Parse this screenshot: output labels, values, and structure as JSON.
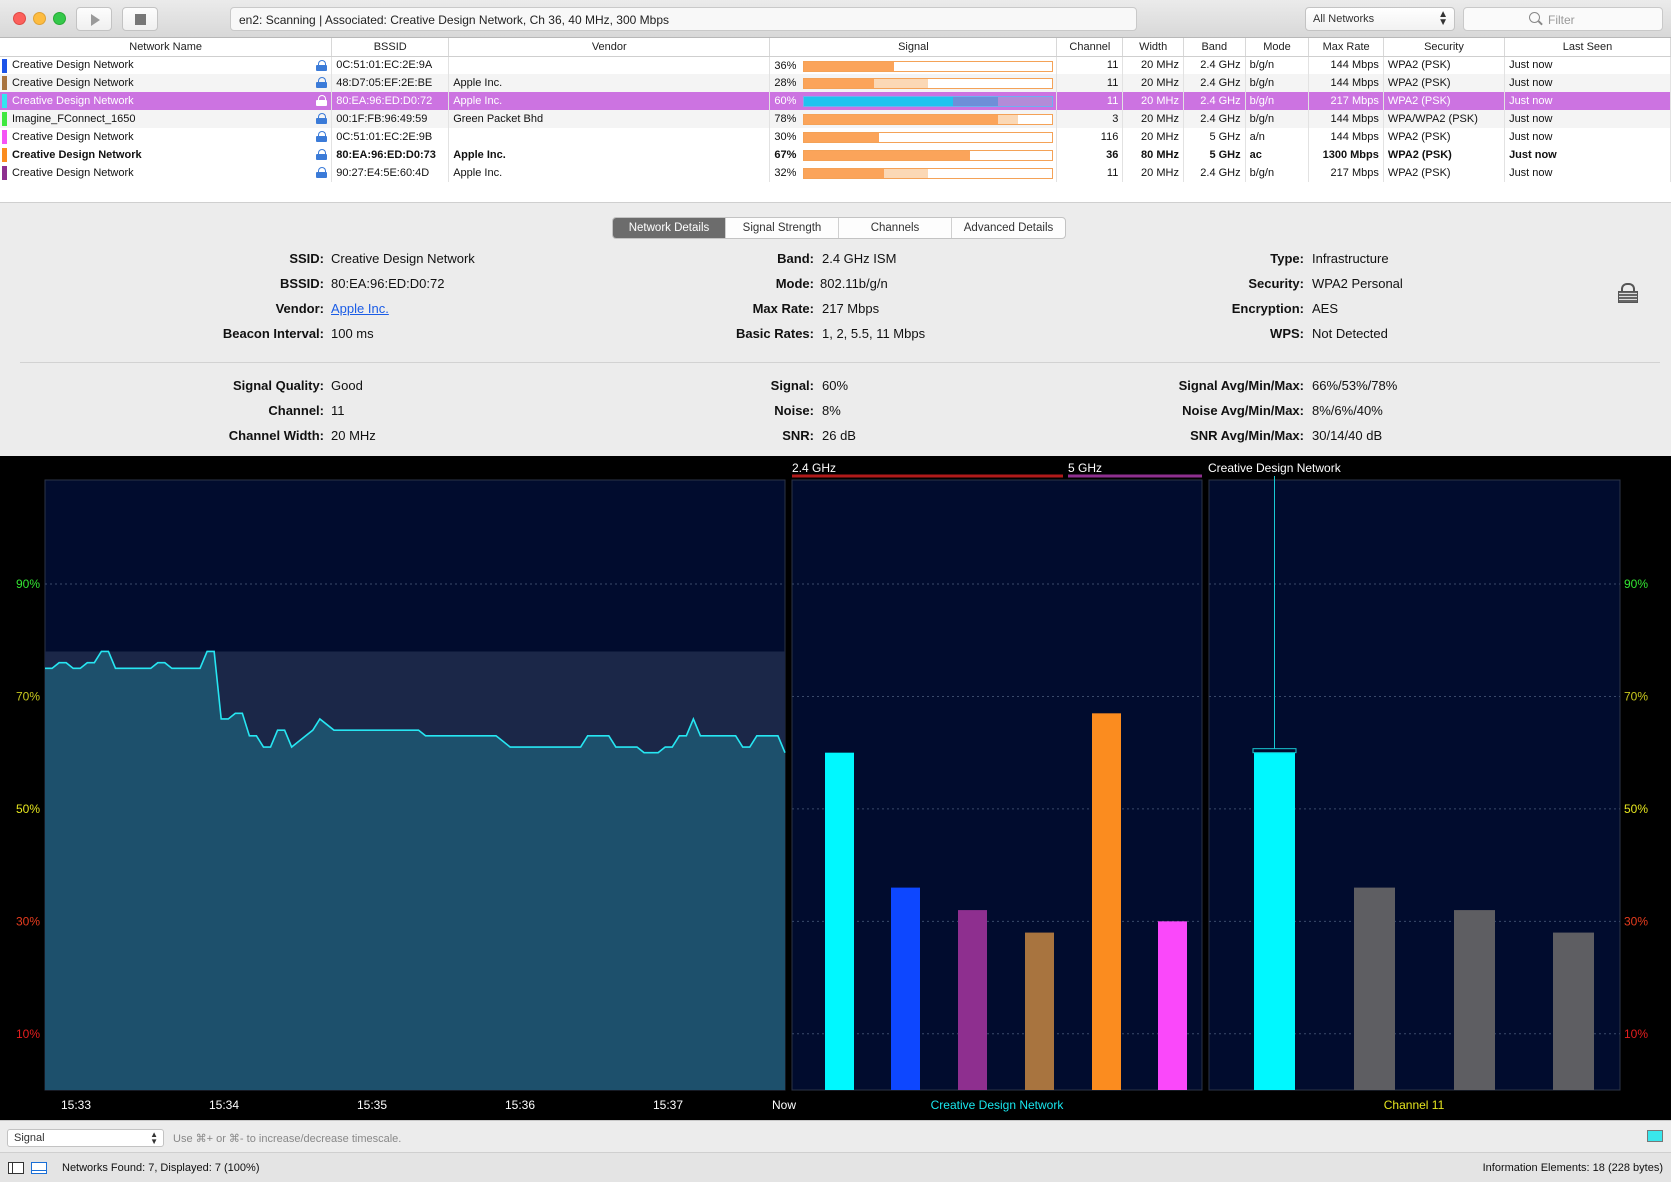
{
  "titlebar": {
    "status": "en2: Scanning  |  Associated: Creative Design Network, Ch 36, 40 MHz, 300 Mbps",
    "network_filter": "All Networks",
    "filter_placeholder": "Filter"
  },
  "table": {
    "columns": [
      "Network Name",
      "BSSID",
      "Vendor",
      "Signal",
      "Channel",
      "Width",
      "Band",
      "Mode",
      "Max Rate",
      "Security",
      "Last Seen"
    ],
    "rows": [
      {
        "color": "#1d54e8",
        "name": "Creative Design Network",
        "bssid": "0C:51:01:EC:2E:9A",
        "vendor": "",
        "signal": "36%",
        "signal_value": 0.36,
        "signal_avg": 0.36,
        "channel": "11",
        "width": "20 MHz",
        "band": "2.4 GHz",
        "mode": "b/g/n",
        "max_rate": "144 Mbps",
        "security": "WPA2 (PSK)",
        "last_seen": "Just now",
        "style": "normal"
      },
      {
        "color": "#a8743f",
        "name": "Creative Design Network",
        "bssid": "48:D7:05:EF:2E:BE",
        "vendor": "Apple Inc.",
        "signal": "28%",
        "signal_value": 0.28,
        "signal_avg": 0.5,
        "channel": "11",
        "width": "20 MHz",
        "band": "2.4 GHz",
        "mode": "b/g/n",
        "max_rate": "144 Mbps",
        "security": "WPA2 (PSK)",
        "last_seen": "Just now",
        "style": "alt"
      },
      {
        "color": "#33e6f0",
        "name": "Creative Design Network",
        "bssid": "80:EA:96:ED:D0:72",
        "vendor": "Apple Inc.",
        "signal": "60%",
        "signal_value": 0.6,
        "signal_avg": 0.78,
        "channel": "11",
        "width": "20 MHz",
        "band": "2.4 GHz",
        "mode": "b/g/n",
        "max_rate": "217 Mbps",
        "security": "WPA2 (PSK)",
        "last_seen": "Just now",
        "style": "sel"
      },
      {
        "color": "#3fe83f",
        "name": "Imagine_FConnect_1650",
        "bssid": "00:1F:FB:96:49:59",
        "vendor": "Green Packet Bhd",
        "signal": "78%",
        "signal_value": 0.78,
        "signal_avg": 0.86,
        "channel": "3",
        "width": "20 MHz",
        "band": "2.4 GHz",
        "mode": "b/g/n",
        "max_rate": "144 Mbps",
        "security": "WPA/WPA2 (PSK)",
        "last_seen": "Just now",
        "style": "alt"
      },
      {
        "color": "#f554f5",
        "name": "Creative Design Network",
        "bssid": "0C:51:01:EC:2E:9B",
        "vendor": "",
        "signal": "30%",
        "signal_value": 0.3,
        "signal_avg": 0.3,
        "channel": "116",
        "width": "20 MHz",
        "band": "5 GHz",
        "mode": "a/n",
        "max_rate": "144 Mbps",
        "security": "WPA2 (PSK)",
        "last_seen": "Just now",
        "style": "normal"
      },
      {
        "color": "#fb8c1f",
        "name": "Creative Design Network",
        "bssid": "80:EA:96:ED:D0:73",
        "vendor": "Apple Inc.",
        "signal": "67%",
        "signal_value": 0.67,
        "signal_avg": 0.67,
        "channel": "36",
        "width": "80 MHz",
        "band": "5 GHz",
        "mode": "ac",
        "max_rate": "1300 Mbps",
        "security": "WPA2 (PSK)",
        "last_seen": "Just now",
        "style": "bold"
      },
      {
        "color": "#8e2f8f",
        "name": "Creative Design Network",
        "bssid": "90:27:E4:5E:60:4D",
        "vendor": "Apple Inc.",
        "signal": "32%",
        "signal_value": 0.32,
        "signal_avg": 0.5,
        "channel": "11",
        "width": "20 MHz",
        "band": "2.4 GHz",
        "mode": "b/g/n",
        "max_rate": "217 Mbps",
        "security": "WPA2 (PSK)",
        "last_seen": "Just now",
        "style": "normal"
      }
    ]
  },
  "tabs": [
    "Network Details",
    "Signal Strength",
    "Channels",
    "Advanced Details"
  ],
  "details": {
    "ssid_label": "SSID:",
    "ssid": "Creative Design Network",
    "bssid_label": "BSSID:",
    "bssid": "80:EA:96:ED:D0:72",
    "vendor_label": "Vendor:",
    "vendor": "Apple Inc.",
    "beacon_label": "Beacon Interval:",
    "beacon": "100 ms",
    "band_label": "Band:",
    "band": "2.4 GHz ISM",
    "mode_label": "Mode:",
    "mode": "802.11b/g/n",
    "maxrate_label": "Max Rate:",
    "maxrate": "217 Mbps",
    "basic_label": "Basic Rates:",
    "basic": "1, 2, 5.5, 11 Mbps",
    "type_label": "Type:",
    "type": "Infrastructure",
    "security_label": "Security:",
    "security": "WPA2 Personal",
    "encryption_label": "Encryption:",
    "encryption": "AES",
    "wps_label": "WPS:",
    "wps": "Not Detected",
    "quality_label": "Signal Quality:",
    "quality": "Good",
    "channel_label": "Channel:",
    "channel": "11",
    "cwidth_label": "Channel Width:",
    "cwidth": "20 MHz",
    "signal_label": "Signal:",
    "signal": "60%",
    "noise_label": "Noise:",
    "noise": "8%",
    "snr_label": "SNR:",
    "snr": "26 dB",
    "sigavg_label": "Signal Avg/Min/Max:",
    "sigavg": "66%/53%/78%",
    "noiseavg_label": "Noise Avg/Min/Max:",
    "noiseavg": "8%/6%/40%",
    "snravg_label": "SNR Avg/Min/Max:",
    "snravg": "30/14/40 dB"
  },
  "chart_data": [
    {
      "type": "line",
      "title": "",
      "y_ticks": [
        "90%",
        "70%",
        "50%",
        "30%",
        "10%"
      ],
      "ylim": [
        0,
        100
      ],
      "x_ticks": [
        "15:33",
        "15:34",
        "15:35",
        "15:36",
        "15:37",
        "Now"
      ],
      "max_band": 78,
      "series": [
        {
          "color": "#27e6f2",
          "values": [
            75,
            75,
            76,
            76,
            75,
            75,
            76,
            76,
            78,
            78,
            75,
            75,
            75,
            75,
            75,
            75,
            76,
            76,
            75,
            75,
            75,
            75,
            75,
            78,
            78,
            66,
            66,
            67,
            67,
            63,
            63,
            61,
            61,
            64,
            64,
            61,
            62,
            63,
            64,
            66,
            65,
            64,
            64,
            64,
            64,
            64,
            64,
            64,
            64,
            64,
            64,
            64,
            64,
            64,
            63,
            63,
            63,
            63,
            63,
            63,
            63,
            63,
            63,
            63,
            63,
            62,
            61,
            61,
            61,
            61,
            61,
            61,
            61,
            61,
            61,
            61,
            61,
            63,
            63,
            63,
            63,
            61,
            61,
            61,
            61,
            60,
            60,
            60,
            61,
            61,
            63,
            63,
            66,
            63,
            63,
            63,
            63,
            63,
            63,
            61,
            61,
            63,
            63,
            63,
            63,
            60
          ]
        }
      ]
    },
    {
      "type": "bar",
      "title": "Creative Design Network",
      "band_labels": [
        "2.4 GHz",
        "5 GHz"
      ],
      "ylim": [
        0,
        100
      ],
      "values": [
        60,
        36,
        32,
        28,
        67,
        30
      ],
      "colors": [
        "#00f8ff",
        "#0d47ff",
        "#8e2f8f",
        "#a8743f",
        "#fb8c1f",
        "#fa48fa"
      ]
    },
    {
      "type": "bar",
      "title": "Channel 11",
      "header": "Creative Design Network",
      "ylim": [
        0,
        100
      ],
      "values": [
        60,
        36,
        32,
        28
      ],
      "colors": [
        "#00f8ff",
        "#5e5e62",
        "#5e5e62",
        "#5e5e62"
      ]
    }
  ],
  "bottom": {
    "metric": "Signal",
    "hint": "Use ⌘+ or ⌘- to increase/decrease timescale.",
    "found": "Networks Found: 7, Displayed: 7 (100%)",
    "info": "Information Elements: 18 (228 bytes)"
  }
}
